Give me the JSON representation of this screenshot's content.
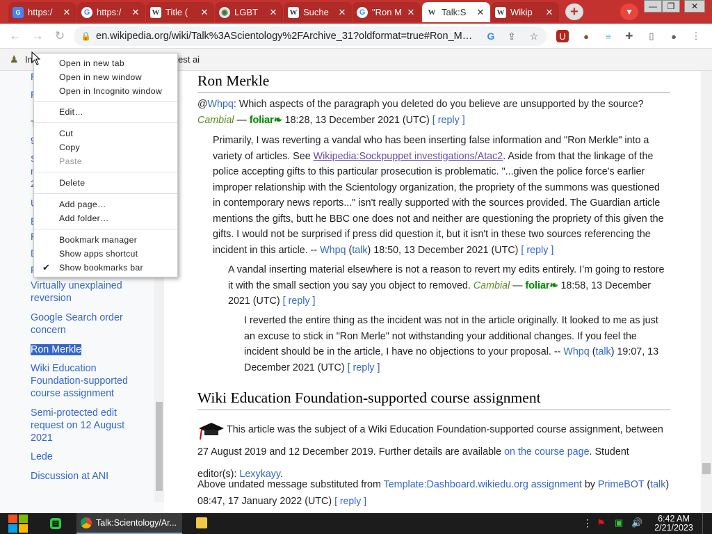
{
  "browser": {
    "tabs": [
      {
        "icon": "google-mail-icon",
        "title": "https:/"
      },
      {
        "icon": "google-icon",
        "title": "https:/"
      },
      {
        "icon": "wikipedia-icon",
        "title": "Title ("
      },
      {
        "icon": "lgbt-wiki-icon",
        "title": "LGBT"
      },
      {
        "icon": "wikipedia-icon",
        "title": "Suche"
      },
      {
        "icon": "google-icon",
        "title": "\"Ron M"
      },
      {
        "icon": "wikipedia-icon",
        "title": "Talk:S"
      },
      {
        "icon": "wikipedia-icon",
        "title": "Wikip"
      }
    ],
    "new_tab": "+",
    "url": "en.wikipedia.org/wiki/Talk%3AScientology%2FArchive_31?oldformat=true#Ron_M…",
    "bookmarks_visible": [
      "In",
      "est ai"
    ]
  },
  "sidebar": {
    "stubs": [
      "F",
      "F",
      "T",
      "9",
      "S",
      "n",
      "2",
      "U",
      "E",
      "F",
      "D",
      "R"
    ],
    "toc": [
      {
        "label": "Virtually unexplained reversion"
      },
      {
        "label": "Google Search order concern"
      },
      {
        "label": "Ron Merkle"
      },
      {
        "label": "Wiki Education Foundation-supported course assignment"
      },
      {
        "label": "Semi-protected edit request on 12 August 2021"
      },
      {
        "label": "Lede"
      },
      {
        "label": "Discussion at ANI"
      }
    ]
  },
  "main": {
    "h_ron": "Ron Merkle",
    "p1": {
      "at": "@",
      "user": "Whpq",
      "text": ": Which aspects of the paragraph you deleted do you believe are unsupported by the source?",
      "sig_user": "Cambial",
      "dash": " — ",
      "sig_extra": "foliar❧",
      "time": " 18:28, 13 December 2021 (UTC) ",
      "reply": "[ reply ]"
    },
    "p2": {
      "text_a": "Primarily, I was reverting a vandal who has been inserting false information and \"Ron Merkle\" into a variety of articles. See ",
      "link": "Wikipedia:Sockpuppet investigations/Atac2",
      "text_b": ". Aside from that the linkage of the police accepting gifts to this particular prosecution is problematic. \"...given the police force's earlier improper relationship with the Scientology organization, the propriety of the summons was questioned in contemporary news reports...\" isn't really supported with the sources provided. The Guardian article mentions the gifts, butt he BBC one does not and neither are questioning the propriety of this given the gifts. I would not be surprised if press did question it, but it isn't in these two sources referencing the incident in this article. -- ",
      "user": "Whpq",
      "talk": "talk",
      "time": " 18:50, 13 December 2021 (UTC) ",
      "reply": "[ reply ]"
    },
    "p3": {
      "text": "A vandal inserting material elsewhere is not a reason to revert my edits entirely. I’m going to restore it with the small section you say you object to removed. ",
      "sig_user": "Cambial",
      "dash": " — ",
      "sig_extra": "foliar❧",
      "time": " 18:58, 13 December 2021 (UTC) ",
      "reply": "[ reply ]"
    },
    "p4": {
      "text": "I reverted the entire thing as the incident was not in the article originally. It looked to me as just an excuse to stick in \"Ron Merle\" not withstanding your additional changes. If you feel the incident should be in the article, I have no objections to your proposal. -- ",
      "user": "Whpq",
      "talk": "talk",
      "time": " 19:07, 13 December 2021 (UTC) ",
      "reply": "[ reply ]"
    },
    "h_wiki": "Wiki Education Foundation-supported course assignment",
    "course": {
      "text_a": "This article was the subject of a Wiki Education Foundation-supported course assignment, between 27 August 2019 and 12 December 2019. Further details are available ",
      "link": "on the course page",
      "text_b": ". Student editor(s): ",
      "editor": "Lexykayy",
      "end": "."
    },
    "note": {
      "text_a": "Above undated message substituted from ",
      "template": "Template:Dashboard.wikiedu.org assignment",
      "by": " by ",
      "bot": "PrimeBOT",
      "talk": "talk",
      "time": " 08:47, 17 January 2022 (UTC) ",
      "reply": "[ reply ]"
    }
  },
  "context_menu": {
    "items": [
      {
        "label": "Open in new tab",
        "disabled": false
      },
      {
        "label": "Open in new window",
        "disabled": false
      },
      {
        "label": "Open in Incognito window",
        "disabled": false
      },
      {
        "label": "Edit…",
        "disabled": false
      },
      {
        "label": "Cut",
        "disabled": false
      },
      {
        "label": "Copy",
        "disabled": false
      },
      {
        "label": "Paste",
        "disabled": true
      },
      {
        "label": "Delete",
        "disabled": false
      },
      {
        "label": "Add page…",
        "disabled": false
      },
      {
        "label": "Add folder…",
        "disabled": false
      },
      {
        "label": "Bookmark manager",
        "disabled": false
      },
      {
        "label": "Show apps shortcut",
        "disabled": false
      },
      {
        "label": "Show bookmarks bar",
        "disabled": false,
        "checked": true
      }
    ]
  },
  "taskbar": {
    "app_label": "Talk:Scientology/Ar...",
    "time": "6:42 AM",
    "date": "2/21/2023"
  },
  "colors": {
    "tab_bar": "#c4322f",
    "link": "#3366cc",
    "highlight": "#3366cc"
  }
}
